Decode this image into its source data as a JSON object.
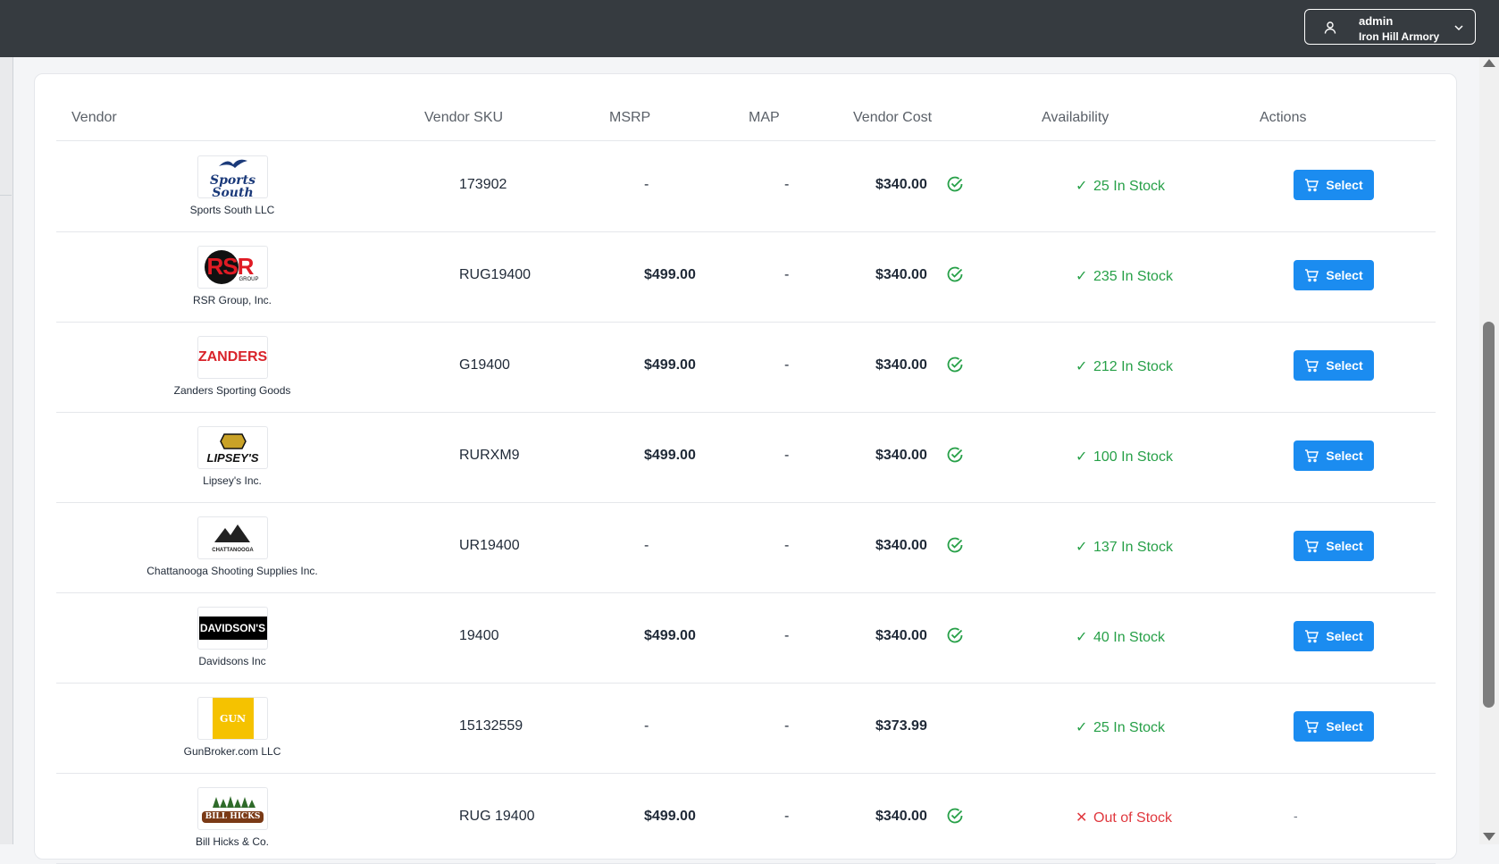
{
  "user_menu": {
    "name": "admin",
    "organization": "Iron Hill Armory"
  },
  "table": {
    "headers": {
      "vendor": "Vendor",
      "sku": "Vendor SKU",
      "msrp": "MSRP",
      "map": "MAP",
      "cost": "Vendor Cost",
      "availability": "Availability",
      "actions": "Actions"
    },
    "rows": [
      {
        "vendor": "Sports South LLC",
        "logo_text": "Sports South",
        "sku": "173902",
        "msrp": "-",
        "map": "-",
        "cost": "$340.00",
        "availability": "25 In Stock",
        "select_label": "Select"
      },
      {
        "vendor": "RSR Group, Inc.",
        "logo_text": "RSR",
        "logo_sub": "GROUP",
        "sku": "RUG19400",
        "msrp": "$499.00",
        "map": "-",
        "cost": "$340.00",
        "availability": "235 In Stock",
        "select_label": "Select"
      },
      {
        "vendor": "Zanders Sporting Goods",
        "logo_text": "ZANDERS",
        "sku": "G19400",
        "msrp": "$499.00",
        "map": "-",
        "cost": "$340.00",
        "availability": "212 In Stock",
        "select_label": "Select"
      },
      {
        "vendor": "Lipsey's Inc.",
        "logo_text": "LIPSEY'S",
        "sku": "RURXM9",
        "msrp": "$499.00",
        "map": "-",
        "cost": "$340.00",
        "availability": "100 In Stock",
        "select_label": "Select"
      },
      {
        "vendor": "Chattanooga Shooting Supplies Inc.",
        "logo_text": "CHATTANOOGA",
        "sku": "UR19400",
        "msrp": "-",
        "map": "-",
        "cost": "$340.00",
        "availability": "137 In Stock",
        "select_label": "Select"
      },
      {
        "vendor": "Davidsons Inc",
        "logo_text": "DAVIDSON'S",
        "sku": "19400",
        "msrp": "$499.00",
        "map": "-",
        "cost": "$340.00",
        "availability": "40 In Stock",
        "select_label": "Select"
      },
      {
        "vendor": "GunBroker.com LLC",
        "logo_text": "GUN",
        "sku": "15132559",
        "msrp": "-",
        "map": "-",
        "cost": "$373.99",
        "availability": "25 In Stock",
        "select_label": "Select"
      },
      {
        "vendor": "Bill Hicks & Co.",
        "logo_text": "BILL HICKS",
        "sku": "RUG 19400",
        "msrp": "$499.00",
        "map": "-",
        "cost": "$340.00",
        "availability": "Out of Stock",
        "action_text": "-"
      }
    ]
  },
  "colors": {
    "topbar": "#363b40",
    "accent": "#1b8cf0",
    "in_stock": "#27a048",
    "out_of_stock": "#e0383e"
  },
  "icons": {
    "user": "user-icon",
    "chevron": "chevron-down-icon",
    "verified": "check-circle-icon",
    "in_stock": "check-icon",
    "out_of_stock": "x-icon",
    "cart": "cart-icon"
  }
}
